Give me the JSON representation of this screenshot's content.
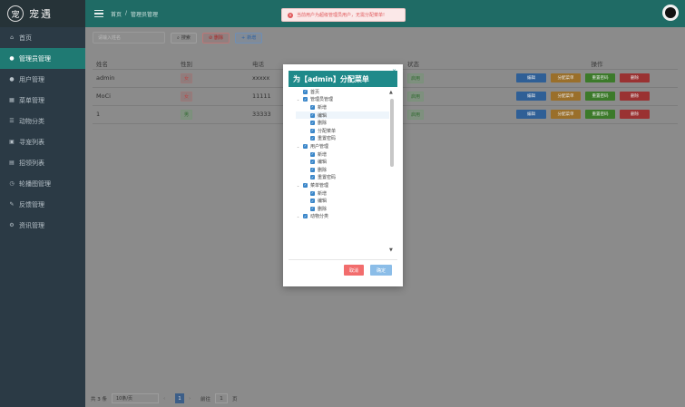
{
  "app": {
    "logo_text": "宠遇",
    "logo_mark": "宠"
  },
  "sidebar": {
    "items": [
      {
        "label": "首页",
        "icon": "home-icon",
        "glyph": "⌂",
        "active": false
      },
      {
        "label": "管理员管理",
        "icon": "user-icon",
        "glyph": "●",
        "active": true
      },
      {
        "label": "用户管理",
        "icon": "user-icon",
        "glyph": "●",
        "active": false
      },
      {
        "label": "菜单管理",
        "icon": "grid-icon",
        "glyph": "▦",
        "active": false
      },
      {
        "label": "动物分类",
        "icon": "list-icon",
        "glyph": "☰",
        "active": false
      },
      {
        "label": "寻宠列表",
        "icon": "file-icon",
        "glyph": "▣",
        "active": false
      },
      {
        "label": "招领列表",
        "icon": "doc-icon",
        "glyph": "▤",
        "active": false
      },
      {
        "label": "轮播图管理",
        "icon": "clock-icon",
        "glyph": "◷",
        "active": false
      },
      {
        "label": "反馈管理",
        "icon": "edit-icon",
        "glyph": "✎",
        "active": false
      },
      {
        "label": "资讯管理",
        "icon": "settings-icon",
        "glyph": "⚙",
        "active": false
      }
    ]
  },
  "header": {
    "crumb_home": "首页",
    "crumb_sep": "/",
    "crumb_current": "管理员管理"
  },
  "toast": {
    "text": "当前用户为超级管理员用户，无需分配菜单!",
    "icon": "×"
  },
  "toolbar": {
    "search_placeholder": "请输入姓名",
    "search_label": "搜索",
    "batch_delete_label": "删除",
    "add_label": "新增",
    "search_icon": "⌕",
    "delete_icon": "⊘",
    "add_icon": "+"
  },
  "table": {
    "headers": [
      "姓名",
      "性别",
      "电话",
      "邮箱",
      "状态",
      "操作"
    ],
    "rows": [
      {
        "name": "admin",
        "gender": "女",
        "gender_color": "red",
        "phone": "xxxxx",
        "status": "启用"
      },
      {
        "name": "MoCi",
        "gender": "女",
        "gender_color": "red",
        "phone": "11111",
        "status": "启用"
      },
      {
        "name": "1",
        "gender": "男",
        "gender_color": "green",
        "phone": "33333",
        "status": "启用"
      }
    ],
    "op_edit": "编辑",
    "op_assign": "分配菜单",
    "op_reset": "重置密码",
    "op_delete": "删除"
  },
  "pager": {
    "total": "共 3 条",
    "size": "10条/页",
    "current_page": "1",
    "goto_label": "前往",
    "goto_value": "1",
    "page_unit": "页",
    "prev": "‹",
    "next": "›"
  },
  "modal": {
    "title": "为【admin】分配菜单",
    "close": "×",
    "tree": [
      {
        "label": "首页",
        "level": 1,
        "caret": ""
      },
      {
        "label": "管理员管理",
        "level": 1,
        "caret": "⌄"
      },
      {
        "label": "新增",
        "level": 2,
        "caret": ""
      },
      {
        "label": "编辑",
        "level": 2,
        "caret": "",
        "selected": true
      },
      {
        "label": "删除",
        "level": 2,
        "caret": ""
      },
      {
        "label": "分配菜单",
        "level": 2,
        "caret": ""
      },
      {
        "label": "重置密码",
        "level": 2,
        "caret": ""
      },
      {
        "label": "用户管理",
        "level": 1,
        "caret": "⌄"
      },
      {
        "label": "新增",
        "level": 2,
        "caret": ""
      },
      {
        "label": "编辑",
        "level": 2,
        "caret": ""
      },
      {
        "label": "删除",
        "level": 2,
        "caret": ""
      },
      {
        "label": "重置密码",
        "level": 2,
        "caret": ""
      },
      {
        "label": "菜单管理",
        "level": 1,
        "caret": "⌄"
      },
      {
        "label": "新增",
        "level": 2,
        "caret": ""
      },
      {
        "label": "编辑",
        "level": 2,
        "caret": ""
      },
      {
        "label": "删除",
        "level": 2,
        "caret": ""
      },
      {
        "label": "动物分类",
        "level": 1,
        "caret": "⌄"
      }
    ],
    "check_glyph": "✓",
    "cancel_label": "取消",
    "confirm_label": "确定"
  }
}
